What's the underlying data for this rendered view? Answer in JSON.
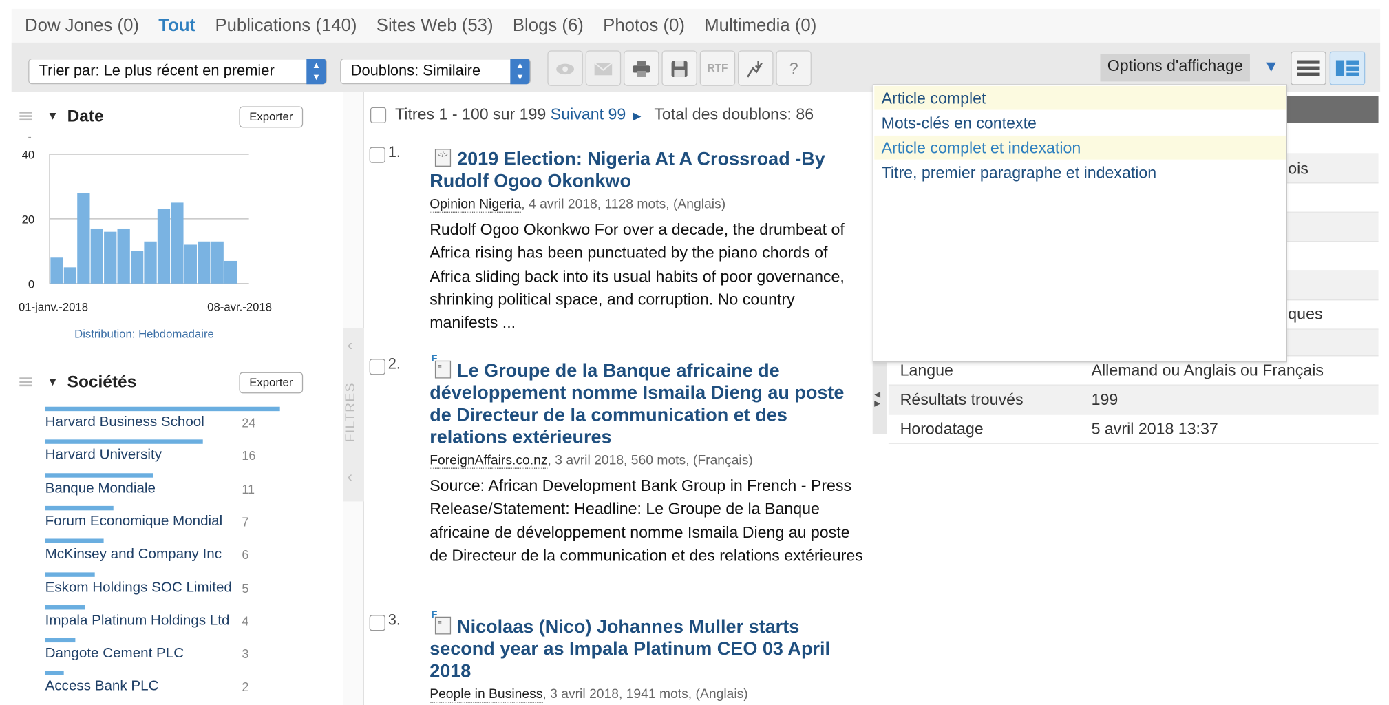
{
  "tabs": [
    {
      "label": "Dow Jones (0)",
      "active": false
    },
    {
      "label": "Tout",
      "active": true
    },
    {
      "label": "Publications (140)",
      "active": false
    },
    {
      "label": "Sites Web (53)",
      "active": false
    },
    {
      "label": "Blogs (6)",
      "active": false
    },
    {
      "label": "Photos (0)",
      "active": false
    },
    {
      "label": "Multimedia (0)",
      "active": false
    }
  ],
  "toolbar": {
    "sort_label": "Trier par: Le plus récent en premier",
    "dupes_label": "Doublons: Similaire",
    "rtf_label": "RTF",
    "help_label": "?",
    "display_options_label": "Options d'affichage",
    "icons": [
      "eye-icon",
      "email-icon",
      "print-icon",
      "save-icon",
      "rtf-icon",
      "download-icon",
      "help-icon",
      "list-view-icon",
      "split-view-icon"
    ]
  },
  "date_facet": {
    "title": "Date",
    "export_label": "Exporter",
    "distribution_label": "Distribution: Hebdomadaire",
    "chart_data": {
      "type": "bar",
      "categories": [
        "01-janv.-2018",
        "",
        "",
        "",
        "",
        "",
        "",
        "",
        "",
        "",
        "",
        "",
        "",
        "",
        "08-avr.-2018",
        ""
      ],
      "values": [
        8,
        5,
        28,
        17,
        16,
        17,
        10,
        13,
        23,
        25,
        12,
        13,
        13,
        7
      ],
      "yticks": [
        0,
        20,
        40
      ],
      "ylim": [
        0,
        40
      ],
      "xtick_labels": [
        "01-janv.-2018",
        "08-avr.-2018"
      ],
      "bar_color": "#7ab3e2"
    }
  },
  "companies_facet": {
    "title": "Sociétés",
    "export_label": "Exporter",
    "items": [
      {
        "name": "Harvard Business School",
        "count": "24",
        "share": 1.0
      },
      {
        "name": "Harvard University",
        "count": "16",
        "share": 0.67
      },
      {
        "name": "Banque Mondiale",
        "count": "11",
        "share": 0.46
      },
      {
        "name": "Forum Economique Mondial",
        "count": "7",
        "share": 0.29
      },
      {
        "name": "McKinsey and Company Inc",
        "count": "6",
        "share": 0.25
      },
      {
        "name": "Eskom Holdings SOC Limited",
        "count": "5",
        "share": 0.21
      },
      {
        "name": "Impala Platinum Holdings Ltd",
        "count": "4",
        "share": 0.17
      },
      {
        "name": "Dangote Cement PLC",
        "count": "3",
        "share": 0.13
      },
      {
        "name": "Access Bank PLC",
        "count": "2",
        "share": 0.08
      }
    ]
  },
  "filter_strip": {
    "label": "FILTRES"
  },
  "results": {
    "header_prefix": "Titres 1 - 100 sur 199",
    "next_label": "Suivant 99",
    "duplicates_label": "Total des doublons: 86",
    "items": [
      {
        "number": "1.",
        "title": "2019 Election: Nigeria At A Crossroad -By Rudolf Ogoo Okonkwo",
        "source": "Opinion Nigeria",
        "meta": ", 4 avril 2018, 1128 mots, (Anglais)",
        "snippet": "Rudolf Ogoo Okonkwo For over a decade, the drumbeat of Africa rising has been punctuated by the piano chords of Africa sliding back into its usual habits of poor governance, shrinking political space, and corruption. No country manifests ..."
      },
      {
        "number": "2.",
        "title": "Le Groupe de la Banque africaine de développement nomme Ismaila Dieng au poste de Directeur de la communication et des relations extérieures",
        "source": "ForeignAffairs.co.nz",
        "meta": ", 3 avril 2018, 560 mots, (Français)",
        "snippet": "Source: African Development Bank Group in French - Press Release/Statement: Headline: Le Groupe de la Banque africaine de développement nomme Ismaila Dieng au poste de Directeur de la communication et des relations extérieures"
      },
      {
        "number": "3.",
        "title": "Nicolaas (Nico) Johannes Muller starts second year as Impala Platinum CEO 03 April 2018",
        "source": "People in Business",
        "meta": ", 3 avril 2018, 1941 mots, (Anglais)",
        "snippet": ""
      }
    ]
  },
  "display_options": {
    "items": [
      {
        "label": "Article complet",
        "highlighted": true
      },
      {
        "label": "Mots-clés en contexte",
        "highlighted": false
      },
      {
        "label": "Article complet et indexation",
        "highlighted": true
      },
      {
        "label": "Titre, premier paragraphe et indexation",
        "highlighted": false
      }
    ]
  },
  "search_summary": {
    "peek_1": "ois",
    "peek_2": "ques",
    "rows": [
      {
        "label": "Langue",
        "value": "Allemand ou Anglais ou Français"
      },
      {
        "label": "Résultats trouvés",
        "value": "199"
      },
      {
        "label": "Horodatage",
        "value": "5 avril 2018 13:37"
      }
    ]
  }
}
